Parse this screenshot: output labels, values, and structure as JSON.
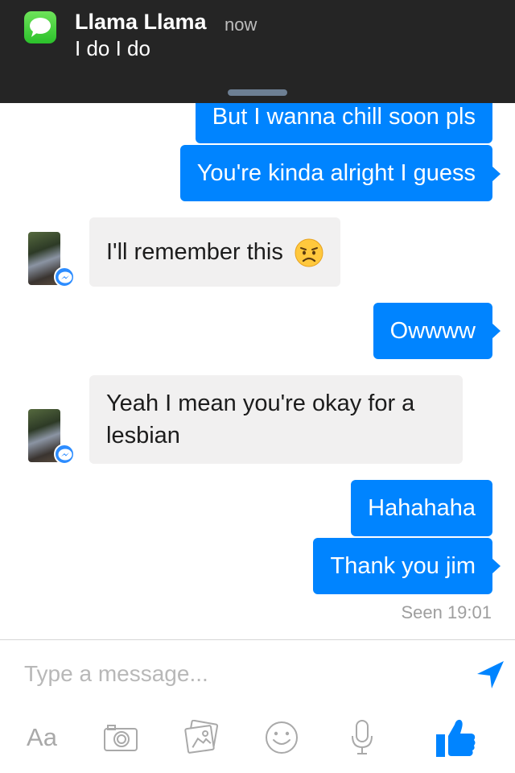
{
  "notification": {
    "sender": "Llama Llama",
    "time": "now",
    "message": "I do I do"
  },
  "messages": [
    {
      "direction": "outgoing",
      "text": "But I wanna chill soon pls"
    },
    {
      "direction": "outgoing",
      "text": "You're kinda alright I guess"
    },
    {
      "direction": "incoming",
      "text": "I'll remember this",
      "emoji": "disappointed-face-emoji"
    },
    {
      "direction": "outgoing",
      "text": "Owwww"
    },
    {
      "direction": "incoming",
      "text": "Yeah I mean you're okay for a lesbian"
    },
    {
      "direction": "outgoing",
      "text": "Hahahaha"
    },
    {
      "direction": "outgoing",
      "text": "Thank you jim"
    }
  ],
  "seen_status": "Seen 19:01",
  "composer": {
    "placeholder": "Type a message...",
    "text_format_label": "Aa"
  },
  "toolbar_icons": [
    "text-format",
    "camera-icon",
    "gallery-icon",
    "emoji-icon",
    "microphone-icon",
    "thumbs-up-icon"
  ],
  "colors": {
    "outgoing_bubble": "#0084ff",
    "incoming_bubble": "#f1f0f0",
    "banner_background": "#252525",
    "accent": "#0084ff"
  }
}
